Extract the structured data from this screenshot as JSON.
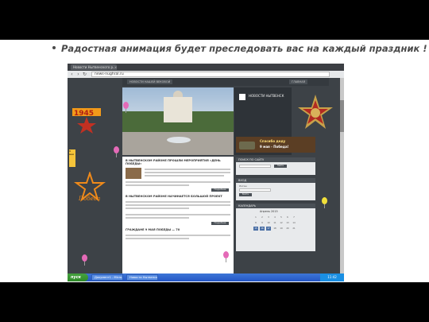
{
  "slide": {
    "bullet_text": "Радостная анимация будет преследовать вас на каждый праздник !"
  },
  "browser": {
    "tab_title": "Новости Нытвенского р...",
    "tab_close": "×",
    "back_icon": "‹",
    "forward_icon": "›",
    "reload_icon": "↻",
    "url": "news-nughral.ru"
  },
  "site": {
    "top_tab_1": "НОВОСТИ НАШЕЙ ВЕКОВОЙ",
    "top_tab_2": "ГЛАВНАЯ",
    "header_title": "НОВОСТИ НЫТВЕНСК",
    "headline": "В НЫТВЕНСКОМ РАЙОНЕ ПРОШЛИ МЕРОПРИЯТИЯ «ДЕНЬ ПОБЕДЫ»",
    "sub_head_1": "В НЫТВЕНСКОМ РАЙОНЕ НАЧИНАЕТСЯ БОЛЬШОЙ ПРОЕКТ",
    "sub_head_2": "ГРАЖДАНЕ 9 МАЯ ПОБЕДЫ — 70",
    "read_more": "Подробнее",
    "ribbon_text": "9 мая",
    "pobeda_text": "Победа",
    "banner_line_1": "Спасибо деду",
    "banner_line_2": "9 мая - Победа!",
    "search_head": "ПОИСК ПО САЙТУ",
    "login_head": "ВХОД",
    "login_label": "Логин",
    "search_btn": "Найти",
    "login_btn": "Войти",
    "calendar_head": "КАЛЕНДАРЬ",
    "calendar_title": "Апрель 2015",
    "calendar_days": [
      "1",
      "2",
      "3",
      "4",
      "5",
      "6",
      "7",
      "8",
      "9",
      "10",
      "11",
      "12",
      "13",
      "14",
      "15",
      "16",
      "17",
      "18",
      "19",
      "20",
      "21"
    ]
  },
  "taskbar": {
    "start_label": "пуск",
    "task_1": "Документ1 - Micro...",
    "task_2": "Новости Нытвенск...",
    "clock": "11:42"
  },
  "colors": {
    "accent": "#4a5056",
    "taskbar": "#2456c6",
    "start": "#3a9a34"
  }
}
